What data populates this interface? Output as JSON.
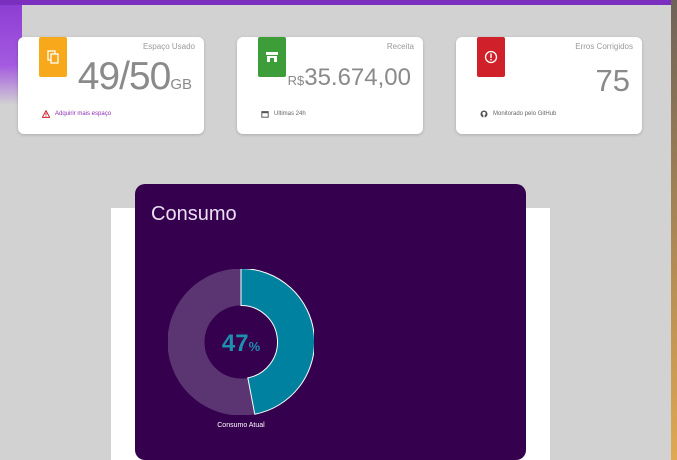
{
  "colors": {
    "accent_purple": "#7b2fbf",
    "storage_badge": "#f7a81b",
    "revenue_badge": "#3d9d39",
    "errors_badge": "#d0202a",
    "panel_bg": "#35004e",
    "donut_fill": "#00819f"
  },
  "cards": {
    "storage": {
      "icon": "copy-icon",
      "label": "Espaço Usado",
      "value": "49/50",
      "unit": "GB",
      "footer_icon": "warning-icon",
      "footer": "Adquirir mais espaço"
    },
    "revenue": {
      "icon": "store-icon",
      "label": "Receita",
      "prefix": "R$",
      "value": "35.674,00",
      "footer_icon": "calendar-icon",
      "footer": "Ultimas 24h"
    },
    "errors": {
      "icon": "info-icon",
      "label": "Erros Corrigidos",
      "value": "75",
      "footer_icon": "github-icon",
      "footer": "Monitorado pelo GitHub"
    }
  },
  "consumo": {
    "title": "Consumo",
    "percent": 47,
    "percent_value": "47",
    "percent_sign": "%",
    "caption": "Consumo Atual"
  }
}
